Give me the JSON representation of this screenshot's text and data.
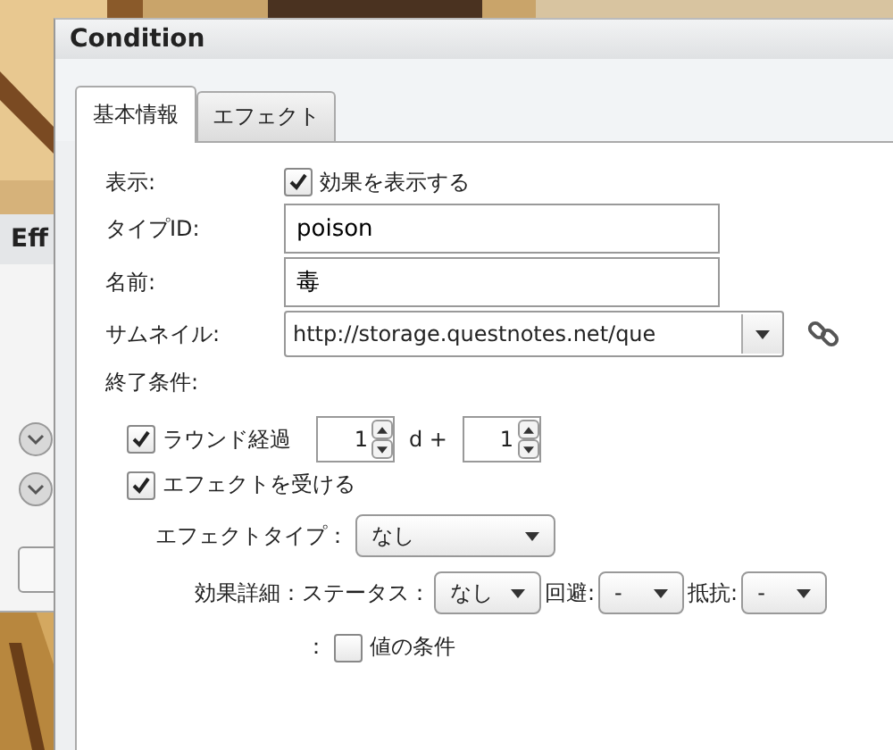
{
  "back_window": {
    "title": "Eff"
  },
  "window": {
    "title": "Condition"
  },
  "tabs": [
    {
      "label": "基本情報",
      "selected": true
    },
    {
      "label": "エフェクト",
      "selected": false
    }
  ],
  "display": {
    "label": "表示:",
    "checkbox": {
      "label": "効果を表示する",
      "checked": true
    }
  },
  "type_id": {
    "label": "タイプID:",
    "value": "poison"
  },
  "name": {
    "label": "名前:",
    "value": "毒"
  },
  "thumbnail": {
    "label": "サムネイル:",
    "value": "http://storage.questnotes.net/que"
  },
  "end_conditions": {
    "label": "終了条件:",
    "round": {
      "label": "ラウンド経過",
      "checked": true,
      "dice_count": "1",
      "d": "d +",
      "bonus": "1"
    },
    "effect": {
      "label": "エフェクトを受ける",
      "checked": true
    },
    "effect_type": {
      "label": "エフェクトタイプ：",
      "value": "なし"
    },
    "detail": {
      "label": "効果詳細：ステータス：",
      "status": "なし",
      "evade_label": "回避:",
      "evade": "-",
      "resist_label": "抵抗:",
      "resist": "-"
    },
    "value": {
      "prefix": "：",
      "label": "値の条件",
      "checked": false
    }
  }
}
